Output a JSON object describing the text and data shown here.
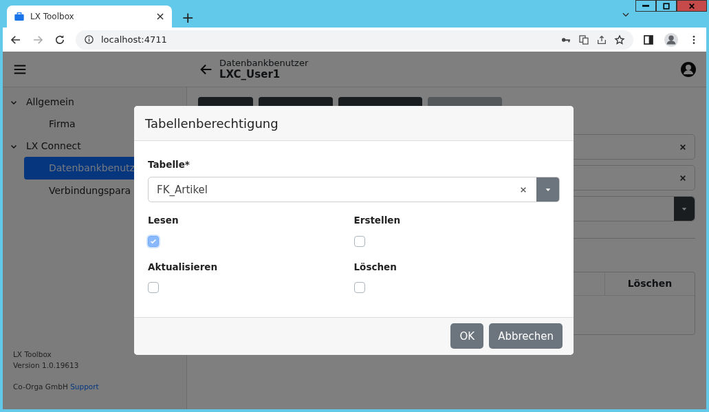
{
  "browser": {
    "tab_title": "LX Toolbox",
    "new_tab": "+",
    "url": "localhost:4711"
  },
  "header": {
    "breadcrumb": "Datenbankbenutzer",
    "title": "LXC_User1"
  },
  "sidebar": {
    "groups": [
      {
        "label": "Allgemein",
        "expanded": true,
        "children": [
          {
            "label": "Firma",
            "selected": false
          }
        ]
      },
      {
        "label": "LX Connect",
        "expanded": true,
        "children": [
          {
            "label": "Datenbankbenutz",
            "selected": true
          },
          {
            "label": "Verbindungspara",
            "selected": false
          }
        ]
      }
    ],
    "footer": {
      "app_name": "LX Toolbox",
      "version": "Version 1.0.19613",
      "company": "Co-Orga GmbH",
      "link": "Support"
    }
  },
  "toolbar_buttons": [
    {
      "disabled": false
    },
    {
      "disabled": false
    },
    {
      "disabled": false
    },
    {
      "disabled": true
    }
  ],
  "fields": [
    {
      "kind": "clearable"
    },
    {
      "kind": "clearable"
    },
    {
      "kind": "select"
    }
  ],
  "table": {
    "columns": [
      "Löschen"
    ]
  },
  "dialog": {
    "title": "Tabellenberechtigung",
    "field_label": "Tabelle*",
    "value": "FK_Artikel",
    "permissions": [
      {
        "label": "Lesen",
        "checked": true
      },
      {
        "label": "Erstellen",
        "checked": false
      },
      {
        "label": "Aktualisieren",
        "checked": false
      },
      {
        "label": "Löschen",
        "checked": false
      }
    ],
    "buttons": [
      "OK",
      "Abbrechen"
    ]
  }
}
